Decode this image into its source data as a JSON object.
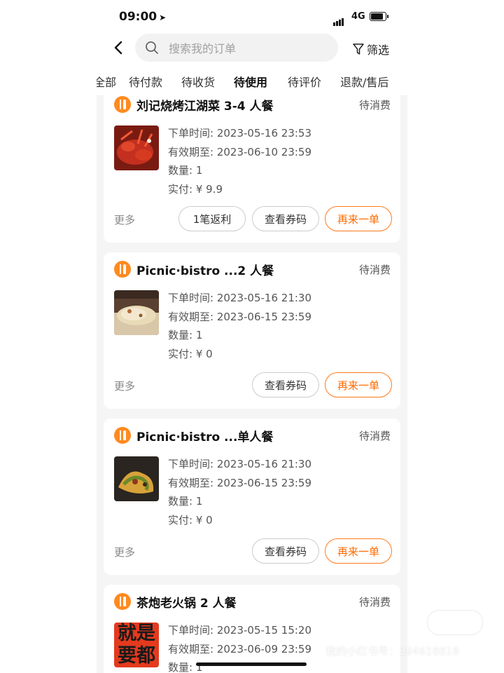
{
  "status_bar": {
    "time": "09:00",
    "network": "4G"
  },
  "header": {
    "search_placeholder": "搜索我的订单",
    "filter_label": "筛选"
  },
  "tabs": [
    {
      "label": "全部"
    },
    {
      "label": "待付款"
    },
    {
      "label": "待收货"
    },
    {
      "label": "待使用",
      "active": true
    },
    {
      "label": "待评价"
    },
    {
      "label": "退款/售后"
    }
  ],
  "labels": {
    "order_time": "下单时间: ",
    "valid_until": "有效期至: ",
    "quantity": "数量: ",
    "paid": "实付: ¥ ",
    "more": "更多"
  },
  "orders": [
    {
      "shop": "刘记烧烤江湖菜 3-4 人餐",
      "status": "待消费",
      "order_time": "2023-05-16 23:53",
      "valid_until": "2023-06-10 23:59",
      "quantity": "1",
      "paid": "9.9",
      "rebate_button": "1笔返利",
      "voucher_button": "查看券码",
      "reorder_button": "再来一单"
    },
    {
      "shop": "Picnic·bistro ...2 人餐",
      "status": "待消费",
      "order_time": "2023-05-16 21:30",
      "valid_until": "2023-06-15 23:59",
      "quantity": "1",
      "paid": "0",
      "voucher_button": "查看券码",
      "reorder_button": "再来一单"
    },
    {
      "shop": "Picnic·bistro ...单人餐",
      "status": "待消费",
      "order_time": "2023-05-16 21:30",
      "valid_until": "2023-06-15 23:59",
      "quantity": "1",
      "paid": "0",
      "voucher_button": "查看券码",
      "reorder_button": "再来一单"
    },
    {
      "shop": "茶炮老火锅 2 人餐",
      "status": "待消费",
      "order_time": "2023-05-15 15:20",
      "valid_until": "2023-06-09 23:59",
      "quantity": "1",
      "thumb_text": "就是要都"
    }
  ],
  "watermark": "我的小红书号：294618818",
  "colors": {
    "accent": "#ff6a00",
    "tab_underline": "#ffc107",
    "shop_icon": "#ff8a1f"
  }
}
